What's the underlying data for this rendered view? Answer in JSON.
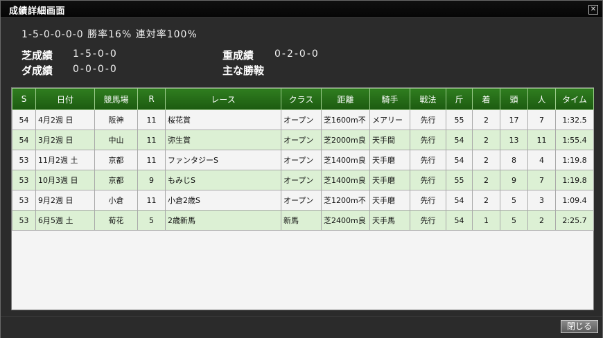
{
  "window": {
    "title": "成績詳細画面",
    "close_glyph": "✕"
  },
  "summary": "1-5-0-0-0-0 勝率16% 連対率100%",
  "stats": {
    "turf_label": "芝成績",
    "turf_value": "1-5-0-0",
    "dirt_label": "ダ成績",
    "dirt_value": "0-0-0-0",
    "heavy_label": "重成績",
    "heavy_value": "0-2-0-0",
    "jockey_label": "主な勝鞍",
    "jockey_value": ""
  },
  "table": {
    "headers": [
      "S",
      "日付",
      "競馬場",
      "R",
      "レース",
      "クラス",
      "距離",
      "騎手",
      "戦法",
      "斤",
      "着",
      "頭",
      "人",
      "タイム"
    ],
    "rows": [
      [
        "54",
        "4月2週 日",
        "阪神",
        "11",
        "桜花賞",
        "オープン",
        "芝1600m不",
        "メアリー",
        "先行",
        "55",
        "2",
        "17",
        "7",
        "1:32.5"
      ],
      [
        "54",
        "3月2週 日",
        "中山",
        "11",
        "弥生賞",
        "オープン",
        "芝2000m良",
        "天手間",
        "先行",
        "54",
        "2",
        "13",
        "11",
        "1:55.4"
      ],
      [
        "53",
        "11月2週 土",
        "京都",
        "11",
        "ファンタジーS",
        "オープン",
        "芝1400m良",
        "天手磨",
        "先行",
        "54",
        "2",
        "8",
        "4",
        "1:19.8"
      ],
      [
        "53",
        "10月3週 日",
        "京都",
        "9",
        "もみじS",
        "オープン",
        "芝1400m良",
        "天手磨",
        "先行",
        "55",
        "2",
        "9",
        "7",
        "1:19.8"
      ],
      [
        "53",
        "9月2週 日",
        "小倉",
        "11",
        "小倉2歳S",
        "オープン",
        "芝1200m不",
        "天手磨",
        "先行",
        "54",
        "2",
        "5",
        "3",
        "1:09.4"
      ],
      [
        "53",
        "6月5週 土",
        "荀花",
        "5",
        "2歳新馬",
        "新馬",
        "芝2400m良",
        "天手馬",
        "先行",
        "54",
        "1",
        "5",
        "2",
        "2:25.7"
      ]
    ]
  },
  "footer": {
    "close_label": "閉じる"
  }
}
